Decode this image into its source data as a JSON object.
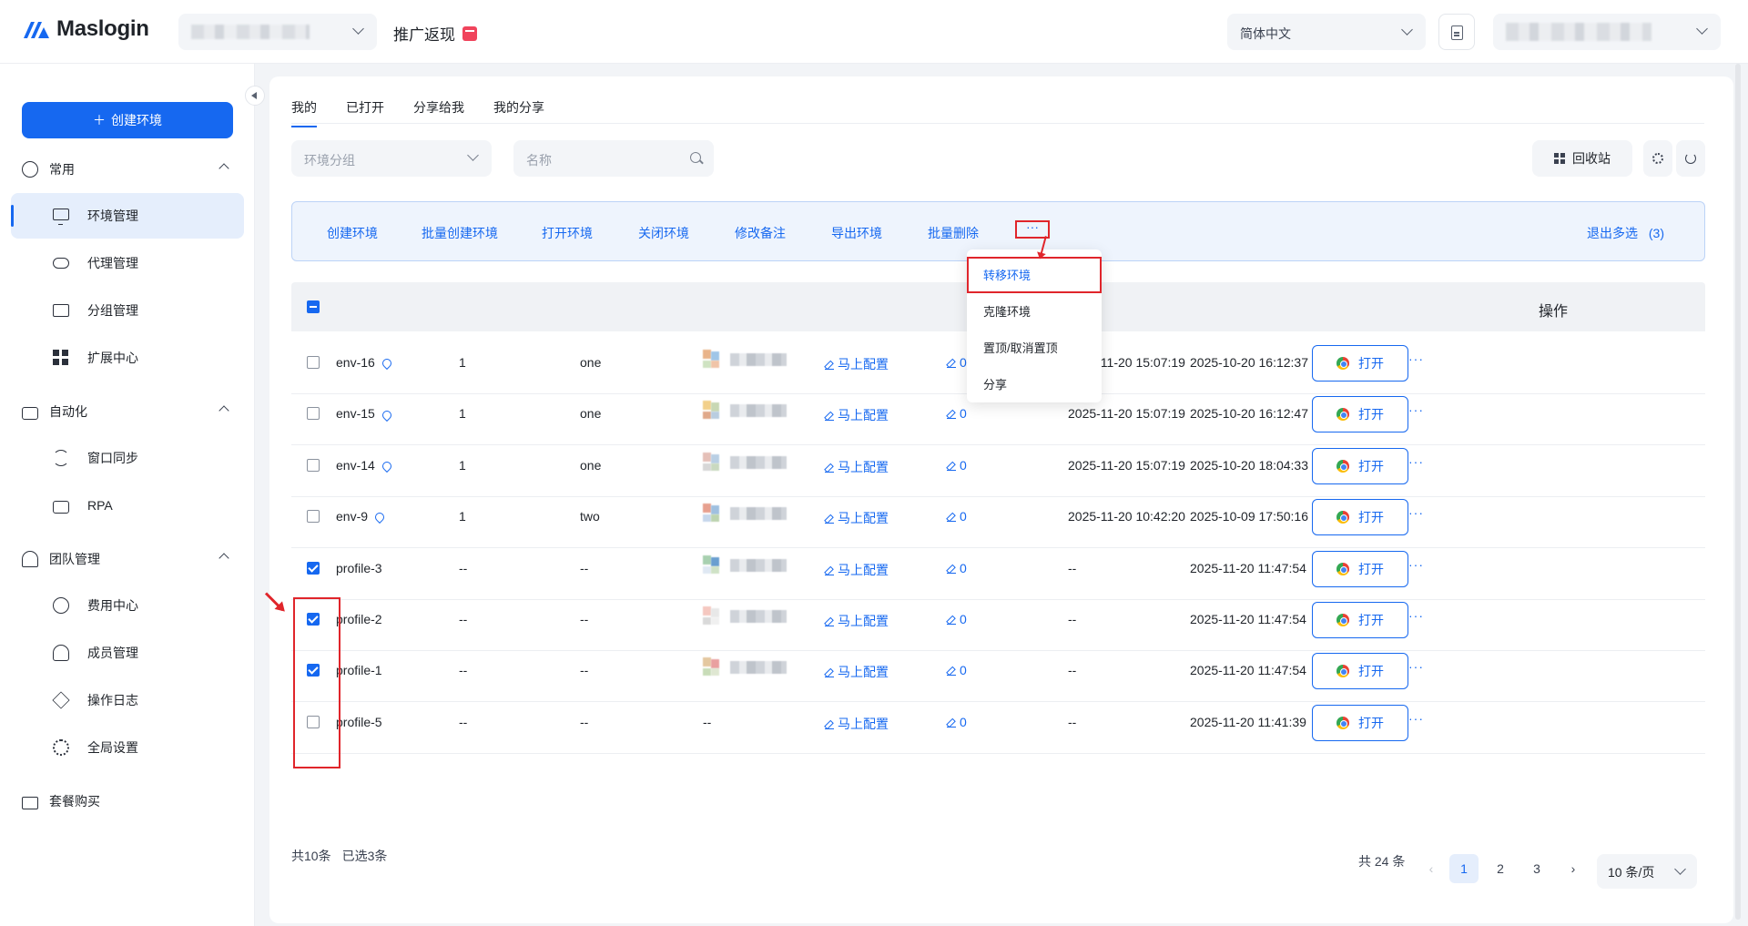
{
  "header": {
    "brand": "Maslogin",
    "promo": "推广返现",
    "language": "简体中文"
  },
  "sidebar": {
    "create_button": "创建环境",
    "groups": [
      {
        "label": "常用",
        "items": [
          "环境管理",
          "代理管理",
          "分组管理",
          "扩展中心"
        ]
      },
      {
        "label": "自动化",
        "items": [
          "窗口同步",
          "RPA"
        ]
      },
      {
        "label": "团队管理",
        "items": [
          "费用中心",
          "成员管理",
          "操作日志",
          "全局设置"
        ]
      }
    ],
    "bottom_item": "套餐购买"
  },
  "tabs": [
    "我的",
    "已打开",
    "分享给我",
    "我的分享"
  ],
  "filters": {
    "group_placeholder": "环境分组",
    "name_placeholder": "名称",
    "recycle_bin": "回收站"
  },
  "batch_bar": {
    "actions": [
      "创建环境",
      "批量创建环境",
      "打开环境",
      "关闭环境",
      "修改备注",
      "导出环境",
      "批量删除"
    ],
    "more": "···",
    "exit_multi": "退出多选",
    "selected_count": "(3)"
  },
  "dropdown": {
    "items": [
      "转移环境",
      "克隆环境",
      "置顶/取消置顶",
      "分享"
    ]
  },
  "table": {
    "ops_header": "操作",
    "open_label": "打开",
    "config_label": "马上配置",
    "rows": [
      {
        "name": "env-16",
        "pinned": true,
        "count": "1",
        "group": "one",
        "config": "马上配置",
        "edit": "0",
        "opened": "2025-11-20 15:07:19",
        "created": "2025-10-20 16:12:37",
        "checked": false
      },
      {
        "name": "env-15",
        "pinned": true,
        "count": "1",
        "group": "one",
        "config": "马上配置",
        "edit": "0",
        "opened": "2025-11-20 15:07:19",
        "created": "2025-10-20 16:12:47",
        "checked": false
      },
      {
        "name": "env-14",
        "pinned": true,
        "count": "1",
        "group": "one",
        "config": "马上配置",
        "edit": "0",
        "opened": "2025-11-20 15:07:19",
        "created": "2025-10-20 18:04:33",
        "checked": false
      },
      {
        "name": "env-9",
        "pinned": true,
        "count": "1",
        "group": "two",
        "config": "马上配置",
        "edit": "0",
        "opened": "2025-11-20 10:42:20",
        "created": "2025-10-09 17:50:16",
        "checked": false
      },
      {
        "name": "profile-3",
        "pinned": false,
        "count": "--",
        "group": "--",
        "config": "马上配置",
        "edit": "0",
        "opened": "--",
        "created": "2025-11-20 11:47:54",
        "checked": true
      },
      {
        "name": "profile-2",
        "pinned": false,
        "count": "--",
        "group": "--",
        "config": "马上配置",
        "edit": "0",
        "opened": "--",
        "created": "2025-11-20 11:47:54",
        "checked": true
      },
      {
        "name": "profile-1",
        "pinned": false,
        "count": "--",
        "group": "--",
        "config": "马上配置",
        "edit": "0",
        "opened": "--",
        "created": "2025-11-20 11:47:54",
        "checked": true
      },
      {
        "name": "profile-5",
        "pinned": false,
        "count": "--",
        "group": "--",
        "proxy": "--",
        "config": "马上配置",
        "edit": "0",
        "opened": "--",
        "created": "2025-11-20 11:41:39",
        "checked": false
      }
    ]
  },
  "footer": {
    "total": "共10条",
    "selected": "已选3条",
    "pager_total": "共 24 条",
    "pages": [
      "1",
      "2",
      "3"
    ],
    "current_page": "1",
    "page_size": "10 条/页"
  },
  "colors": {
    "accent": "#1668f0",
    "annotation": "#e0252b"
  }
}
